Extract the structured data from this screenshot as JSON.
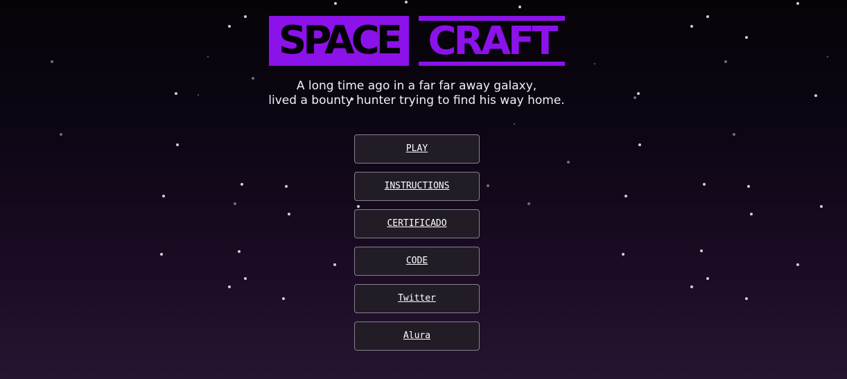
{
  "logo": {
    "part1": "SPACE",
    "part2": "CRAFT",
    "accent_color": "#8c12ea"
  },
  "tagline": {
    "line1": "A long time ago in a far far away galaxy,",
    "line2": "lived a bounty hunter trying to find his way home."
  },
  "menu": {
    "items": [
      {
        "label": "PLAY"
      },
      {
        "label": "INSTRUCTIONS"
      },
      {
        "label": "CERTIFICADO"
      },
      {
        "label": "CODE"
      },
      {
        "label": "Twitter"
      },
      {
        "label": "Alura"
      }
    ]
  }
}
